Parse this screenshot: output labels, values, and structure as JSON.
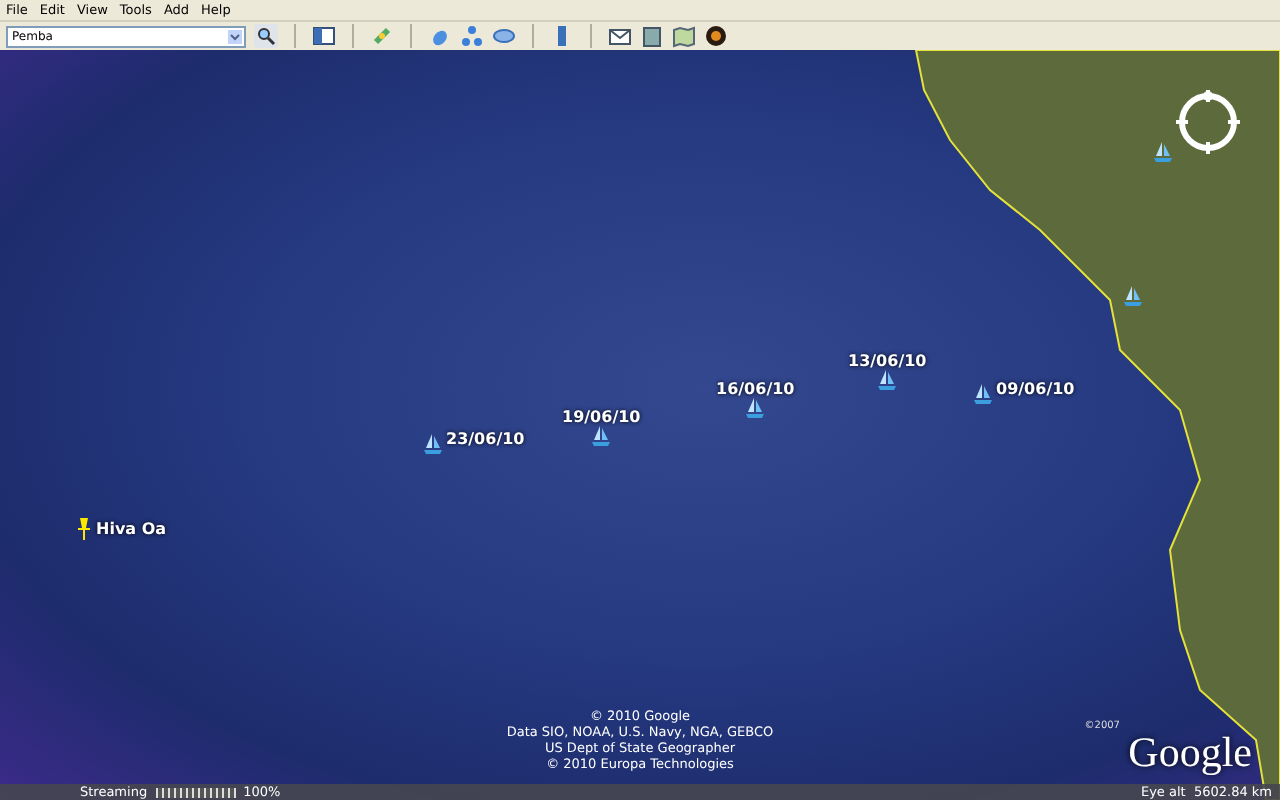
{
  "menu": [
    "File",
    "Edit",
    "View",
    "Tools",
    "Add",
    "Help"
  ],
  "search": {
    "value": "Pemba"
  },
  "map": {
    "placemarks": [
      {
        "label": "09/06/10",
        "kind": "boat"
      },
      {
        "label": "13/06/10",
        "kind": "boat"
      },
      {
        "label": "16/06/10",
        "kind": "boat"
      },
      {
        "label": "19/06/10",
        "kind": "boat"
      },
      {
        "label": "23/06/10",
        "kind": "boat"
      },
      {
        "label": "Hiva Oa",
        "kind": "pin"
      }
    ],
    "attribution": [
      "© 2010 Google",
      "Data SIO, NOAA, U.S. Navy, NGA, GEBCO",
      "US Dept of State Geographer",
      "© 2010 Europa Technologies"
    ],
    "logo_note": "©2007",
    "logo": "Google"
  },
  "status_bar": {
    "streaming": "Streaming",
    "level": 1,
    "percent": "100%",
    "eye_alt": "Eye alt  5602.84 km"
  }
}
